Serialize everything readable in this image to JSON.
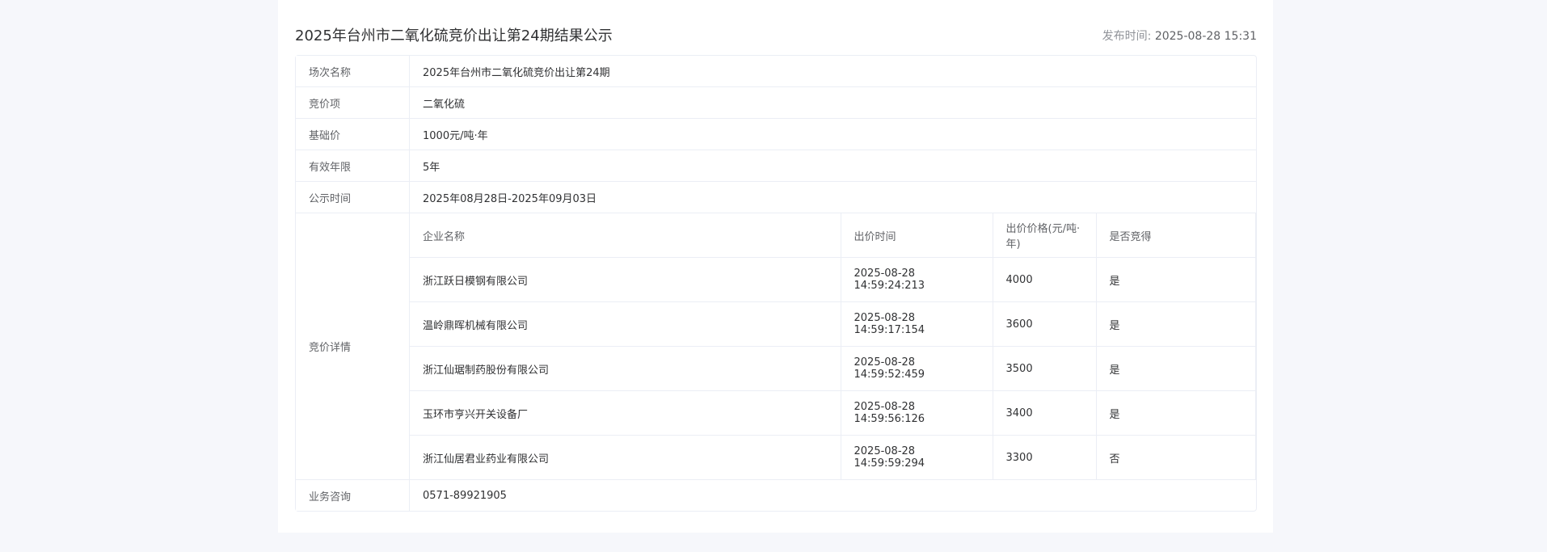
{
  "header": {
    "title": "2025年台州市二氧化硫竞价出让第24期结果公示",
    "publish_label": "发布时间:",
    "publish_value": "2025-08-28 15:31"
  },
  "info": {
    "session_name": {
      "label": "场次名称",
      "value": "2025年台州市二氧化硫竞价出让第24期"
    },
    "bid_item": {
      "label": "竞价项",
      "value": "二氧化硫"
    },
    "base_price": {
      "label": "基础价",
      "value": "1000元/吨·年"
    },
    "valid_years": {
      "label": "有效年限",
      "value": "5年"
    },
    "notice_period": {
      "label": "公示时间",
      "value": "2025年08月28日-2025年09月03日"
    },
    "bid_details": {
      "label": "竞价详情"
    },
    "consult": {
      "label": "业务咨询",
      "value": "0571-89921905"
    }
  },
  "bids": {
    "headers": [
      "企业名称",
      "出价时间",
      "出价价格(元/吨·年)",
      "是否竞得"
    ],
    "rows": [
      [
        "浙江跃日模钢有限公司",
        "2025-08-28 14:59:24:213",
        "4000",
        "是"
      ],
      [
        "温岭鼎晖机械有限公司",
        "2025-08-28 14:59:17:154",
        "3600",
        "是"
      ],
      [
        "浙江仙琚制药股份有限公司",
        "2025-08-28 14:59:52:459",
        "3500",
        "是"
      ],
      [
        "玉环市亨兴开关设备厂",
        "2025-08-28 14:59:56:126",
        "3400",
        "是"
      ],
      [
        "浙江仙居君业药业有限公司",
        "2025-08-28 14:59:59:294",
        "3300",
        "否"
      ]
    ]
  }
}
